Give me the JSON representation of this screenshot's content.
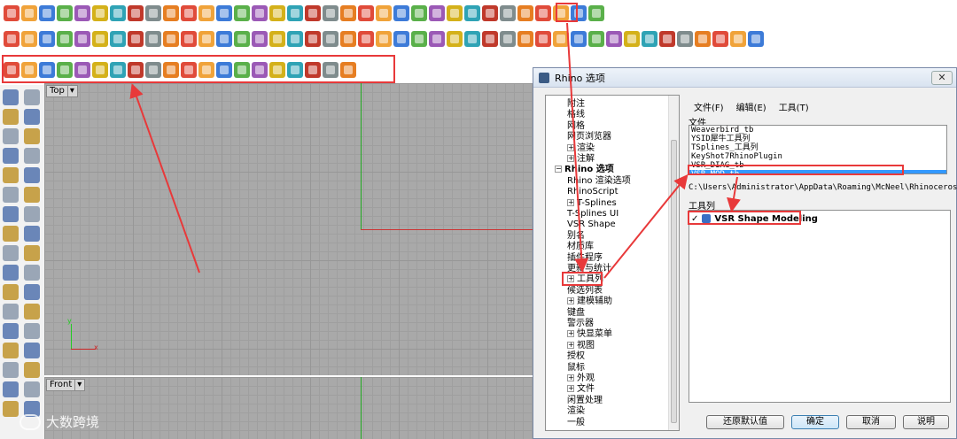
{
  "toolbar1": {
    "icons": [
      "new-file-icon",
      "open-folder-icon",
      "save-icon",
      "print-icon",
      "import-icon",
      "cut-icon",
      "copy-icon",
      "paste-icon",
      "undo-icon",
      "pan-hand-icon",
      "move-view-icon",
      "zoom-icon",
      "zoom-window-icon",
      "zoom-extents-icon",
      "zoom-selected-icon",
      "rotate-view-icon",
      "four-view-icon",
      "car-icon",
      "hide-icon",
      "show-icon",
      "select-icon",
      "light-icon",
      "lock-icon",
      "shade-icon",
      "render-color-icon",
      "sphere-shade-icon",
      "sphere-render-icon",
      "sphere-blue-icon",
      "vsr-icon",
      "settings-options-icon",
      "layout-icon",
      "help-icon",
      "plugin-icon",
      "refresh-icon"
    ]
  },
  "toolbar2": {
    "icons": [
      "power-icon",
      "box-icon",
      "surface-icon",
      "shape-a-icon",
      "shape-b-icon",
      "shape-c-icon",
      "shape-d-icon",
      "shape-e-icon",
      "shape-f-icon",
      "shape-g-icon",
      "shape-h-icon",
      "shape-i-icon",
      "shape-j-icon",
      "shape-k-icon",
      "shape-l-icon",
      "shape-m-icon",
      "shape-n-icon",
      "shape-o-icon",
      "shape-p-icon",
      "shape-q-icon",
      "shape-r-icon",
      "shape-s-icon",
      "shape-t-icon",
      "shape-u-icon",
      "shape-v-icon",
      "shape-w-icon",
      "shape-x-icon",
      "shape-y-icon",
      "shape-z-icon",
      "shape-aa-icon",
      "shape-ab-icon",
      "shape-ac-icon",
      "shape-ad-icon",
      "shape-ae-icon",
      "shape-af-icon",
      "shape-ag-icon",
      "shape-ah-icon",
      "shape-ai-icon",
      "shape-aj-icon",
      "shape-ak-icon",
      "shape-al-icon",
      "shape-am-icon",
      "shape-an-icon"
    ]
  },
  "toolbar3": {
    "icons": [
      "vsr-a-icon",
      "vsr-b-icon",
      "vsr-c-icon",
      "vsr-d-icon",
      "vsr-e-icon",
      "vsr-f-icon",
      "vsr-g-icon",
      "vsr-h-icon",
      "vsr-i-icon",
      "vsr-j-icon",
      "vsr-k-icon",
      "vsr-l-icon",
      "vsr-m-icon",
      "vsr-n-icon",
      "vsr-o-icon",
      "vsr-p-icon",
      "vsr-q-icon",
      "vsr-r-icon",
      "vsr-s-icon",
      "eye-icon"
    ]
  },
  "colors": {
    "toolbar_palette": [
      "#e04b3a",
      "#f0a33a",
      "#3d7bd8",
      "#5ab04a",
      "#9b59b6",
      "#d4b11a",
      "#2fa3b5",
      "#c0392b",
      "#7f8c8d",
      "#e67e22"
    ],
    "highlight": "#e8393a",
    "selection": "#3399ff"
  },
  "viewports": {
    "top_label": "Top",
    "front_label": "Front",
    "axis_x": "x",
    "axis_y": "y"
  },
  "dialog": {
    "title": "Rhino 选项",
    "close": "✕",
    "tree": [
      {
        "label": "附注",
        "indent": 1,
        "expandable": false
      },
      {
        "label": "格线",
        "indent": 1,
        "expandable": false
      },
      {
        "label": "网格",
        "indent": 1,
        "expandable": false
      },
      {
        "label": "网页浏览器",
        "indent": 1,
        "expandable": false
      },
      {
        "label": "渲染",
        "indent": 1,
        "expandable": true
      },
      {
        "label": "注解",
        "indent": 1,
        "expandable": true
      },
      {
        "label": "Rhino 选项",
        "indent": 0,
        "expandable": true,
        "bold": true
      },
      {
        "label": "Rhino 渲染选项",
        "indent": 1,
        "expandable": false
      },
      {
        "label": "RhinoScript",
        "indent": 1,
        "expandable": false
      },
      {
        "label": "T-Splines",
        "indent": 1,
        "expandable": true
      },
      {
        "label": "T-Splines UI",
        "indent": 1,
        "expandable": false
      },
      {
        "label": "VSR Shape",
        "indent": 1,
        "expandable": false
      },
      {
        "label": "别名",
        "indent": 1,
        "expandable": false
      },
      {
        "label": "材质库",
        "indent": 1,
        "expandable": false
      },
      {
        "label": "插件程序",
        "indent": 1,
        "expandable": false
      },
      {
        "label": "更新与统计",
        "indent": 1,
        "expandable": false
      },
      {
        "label": "工具列",
        "indent": 1,
        "expandable": true
      },
      {
        "label": "候选列表",
        "indent": 1,
        "expandable": false
      },
      {
        "label": "建模辅助",
        "indent": 1,
        "expandable": true
      },
      {
        "label": "键盘",
        "indent": 1,
        "expandable": false
      },
      {
        "label": "警示器",
        "indent": 1,
        "expandable": false
      },
      {
        "label": "快显菜单",
        "indent": 1,
        "expandable": true
      },
      {
        "label": "视图",
        "indent": 1,
        "expandable": true
      },
      {
        "label": "授权",
        "indent": 1,
        "expandable": false
      },
      {
        "label": "鼠标",
        "indent": 1,
        "expandable": false
      },
      {
        "label": "外观",
        "indent": 1,
        "expandable": true
      },
      {
        "label": "文件",
        "indent": 1,
        "expandable": true
      },
      {
        "label": "闲置处理",
        "indent": 1,
        "expandable": false
      },
      {
        "label": "渲染",
        "indent": 1,
        "expandable": false
      },
      {
        "label": "一般",
        "indent": 1,
        "expandable": false
      }
    ],
    "menu": {
      "file": "文件(F)",
      "edit": "编辑(E)",
      "tools": "工具(T)"
    },
    "files_label": "文件",
    "files": [
      "Weaverbird_tb",
      "YSID犀牛工具列",
      "TSplines_工具列",
      "KeyShot7RhinoPlugin",
      "VSR_DIAG_tb",
      "VSR_MOD_tb"
    ],
    "selected_file_index": 5,
    "path": "C:\\Users\\Administrator\\AppData\\Roaming\\McNeel\\Rhinoceros\\5.0",
    "toolbars_label": "工具列",
    "toolbar_item": {
      "check": "✓",
      "label": "VSR Shape Modeling"
    },
    "buttons": {
      "restore": "还原默认值",
      "ok": "确定",
      "cancel": "取消",
      "help": "说明"
    }
  },
  "watermark": {
    "text": "大数跨境"
  }
}
